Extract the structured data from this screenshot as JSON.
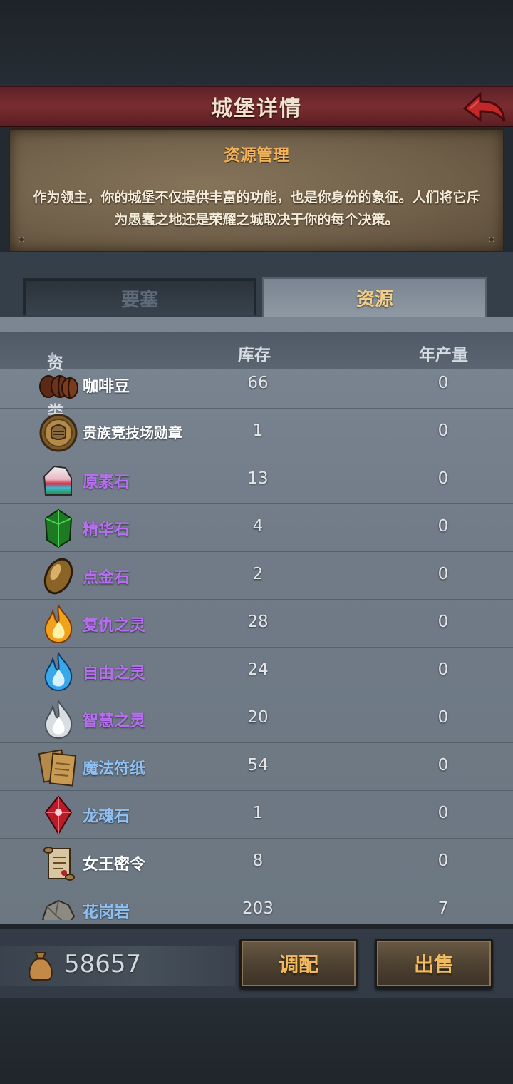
{
  "header": {
    "title": "城堡详情"
  },
  "info": {
    "title": "资源管理",
    "description": "作为领主，你的城堡不仅提供丰富的功能，也是你身份的象征。人们将它斥为愚蠢之地还是荣耀之城取决于你的每个决策。"
  },
  "tabs": [
    {
      "label": "要塞",
      "active": false
    },
    {
      "label": "资源",
      "active": true
    }
  ],
  "table": {
    "headers": {
      "type": "资源类型",
      "stock": "库存",
      "yearly": "年产量"
    },
    "sort_indicator": "▲",
    "rows": [
      {
        "icon": "coffee-bean-icon",
        "name": "咖啡豆",
        "stock": "66",
        "yearly": "0",
        "color": "#ffffff"
      },
      {
        "icon": "arena-medal-icon",
        "name": "贵族竞技场勋章",
        "stock": "1",
        "yearly": "0",
        "color": "#ffffff"
      },
      {
        "icon": "origin-stone-icon",
        "name": "原素石",
        "stock": "13",
        "yearly": "0",
        "color": "#b86ef0"
      },
      {
        "icon": "essence-stone-icon",
        "name": "精华石",
        "stock": "4",
        "yearly": "0",
        "color": "#b86ef0"
      },
      {
        "icon": "gold-stone-icon",
        "name": "点金石",
        "stock": "2",
        "yearly": "0",
        "color": "#b86ef0"
      },
      {
        "icon": "revenge-spirit-icon",
        "name": "复仇之灵",
        "stock": "28",
        "yearly": "0",
        "color": "#b86ef0"
      },
      {
        "icon": "freedom-spirit-icon",
        "name": "自由之灵",
        "stock": "24",
        "yearly": "0",
        "color": "#b86ef0"
      },
      {
        "icon": "wisdom-spirit-icon",
        "name": "智慧之灵",
        "stock": "20",
        "yearly": "0",
        "color": "#b86ef0"
      },
      {
        "icon": "magic-paper-icon",
        "name": "魔法符纸",
        "stock": "54",
        "yearly": "0",
        "color": "#8fc0f2"
      },
      {
        "icon": "dragon-soul-stone-icon",
        "name": "龙魂石",
        "stock": "1",
        "yearly": "0",
        "color": "#8fc0f2"
      },
      {
        "icon": "queen-decree-icon",
        "name": "女王密令",
        "stock": "8",
        "yearly": "0",
        "color": "#ffffff"
      },
      {
        "icon": "granite-icon",
        "name": "花岗岩",
        "stock": "203",
        "yearly": "7",
        "color": "#8fc0f2"
      }
    ]
  },
  "footer": {
    "gold_icon": "money-bag-icon",
    "gold": "58657",
    "allocate_label": "调配",
    "sell_label": "出售"
  }
}
